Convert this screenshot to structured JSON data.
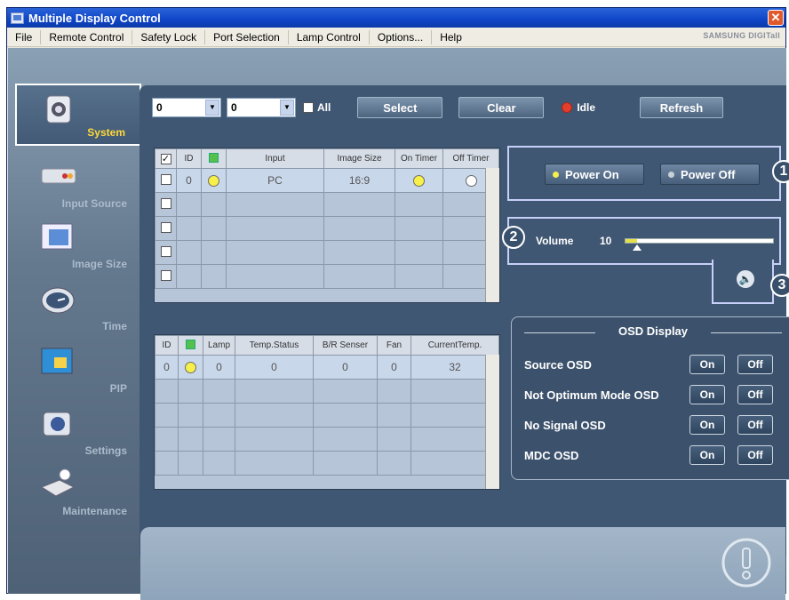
{
  "window": {
    "title": "Multiple Display Control",
    "close": "✕"
  },
  "menu": [
    "File",
    "Remote Control",
    "Safety Lock",
    "Port Selection",
    "Lamp Control",
    "Options...",
    "Help"
  ],
  "brand": "SAMSUNG DIGITall",
  "nav": [
    {
      "label": "System",
      "icon": "system-icon",
      "selected": true
    },
    {
      "label": "Input Source",
      "icon": "input-source-icon"
    },
    {
      "label": "Image Size",
      "icon": "image-size-icon"
    },
    {
      "label": "Time",
      "icon": "clock-icon"
    },
    {
      "label": "PIP",
      "icon": "pip-icon"
    },
    {
      "label": "Settings",
      "icon": "settings-icon"
    },
    {
      "label": "Maintenance",
      "icon": "maintenance-icon"
    }
  ],
  "toolbar": {
    "combo1": "0",
    "combo2": "0",
    "all_label": "All",
    "select": "Select",
    "clear": "Clear",
    "status": "Idle",
    "refresh": "Refresh"
  },
  "table1": {
    "headers": [
      "",
      "ID",
      "",
      "Input",
      "Image Size",
      "On Timer",
      "Off Timer"
    ],
    "rows": [
      {
        "id": "0",
        "input": "PC",
        "size": "16:9"
      }
    ]
  },
  "table2": {
    "headers": [
      "ID",
      "",
      "Lamp",
      "Temp.Status",
      "B/R Senser",
      "Fan",
      "CurrentTemp."
    ],
    "rows": [
      {
        "id": "0",
        "lamp": "0",
        "temp": "0",
        "br": "0",
        "fan": "0",
        "cur": "32"
      }
    ]
  },
  "power": {
    "on": "Power On",
    "off": "Power Off",
    "badge": "1"
  },
  "volume": {
    "label": "Volume",
    "value": "10",
    "level": 0.08,
    "badge": "2"
  },
  "mute": {
    "badge": "3"
  },
  "osd": {
    "title": "OSD Display",
    "rows": [
      {
        "label": "Source OSD",
        "on": "On",
        "off": "Off"
      },
      {
        "label": "Not Optimum Mode OSD",
        "on": "On",
        "off": "Off"
      },
      {
        "label": "No Signal OSD",
        "on": "On",
        "off": "Off"
      },
      {
        "label": "MDC OSD",
        "on": "On",
        "off": "Off"
      }
    ]
  }
}
